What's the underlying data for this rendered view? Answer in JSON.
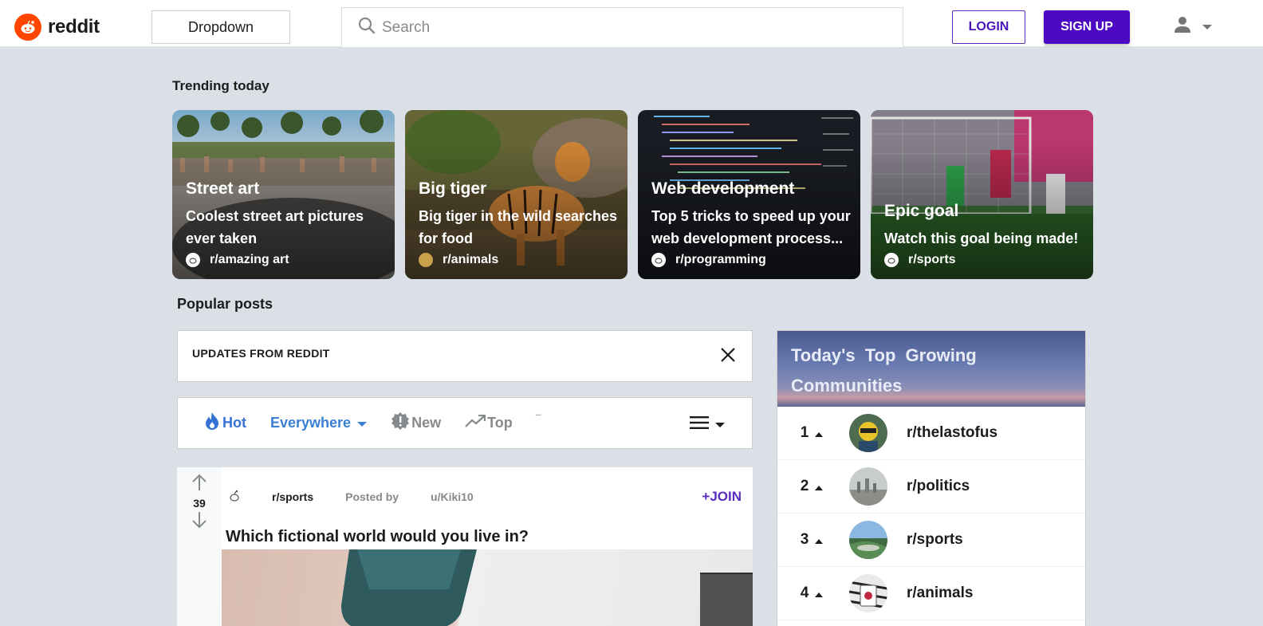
{
  "header": {
    "logo_text": "reddit",
    "dropdown_label": "Dropdown",
    "search_placeholder": "Search",
    "login_label": "LOGIN",
    "signup_label": "SIGN UP"
  },
  "trending": {
    "title": "Trending today",
    "cards": [
      {
        "title": "Street art",
        "desc": "Coolest street art pictures ever taken",
        "sub": "r/amazing art"
      },
      {
        "title": "Big tiger",
        "desc": "Big tiger in the wild searches for food",
        "sub": "r/animals"
      },
      {
        "title": "Web development",
        "desc": "Top 5 tricks to speed up your web development process...",
        "sub": "r/programming"
      },
      {
        "title": "Epic goal",
        "desc": "Watch this goal being made!",
        "sub": "r/sports"
      }
    ]
  },
  "popular": {
    "title": "Popular posts",
    "updates_title": "UPDATES FROM REDDIT",
    "sort": {
      "hot": "Hot",
      "everywhere": "Everywhere",
      "new": "New",
      "top": "Top"
    },
    "post": {
      "votes": "39",
      "subreddit": "r/sports",
      "posted_by": "Posted by",
      "user": "u/Kiki10",
      "join": "+JOIN",
      "title": "Which fictional world would you live in?"
    }
  },
  "communities": {
    "title": "Today's Top Growing Communities",
    "items": [
      {
        "rank": "1",
        "name": "r/thelastofus"
      },
      {
        "rank": "2",
        "name": "r/politics"
      },
      {
        "rank": "3",
        "name": "r/sports"
      },
      {
        "rank": "4",
        "name": "r/animals"
      }
    ]
  },
  "colors": {
    "brand": "#ff4500",
    "accent_purple": "#4d09c1",
    "link_blue": "#3a80d2",
    "background": "#dae0e6"
  }
}
